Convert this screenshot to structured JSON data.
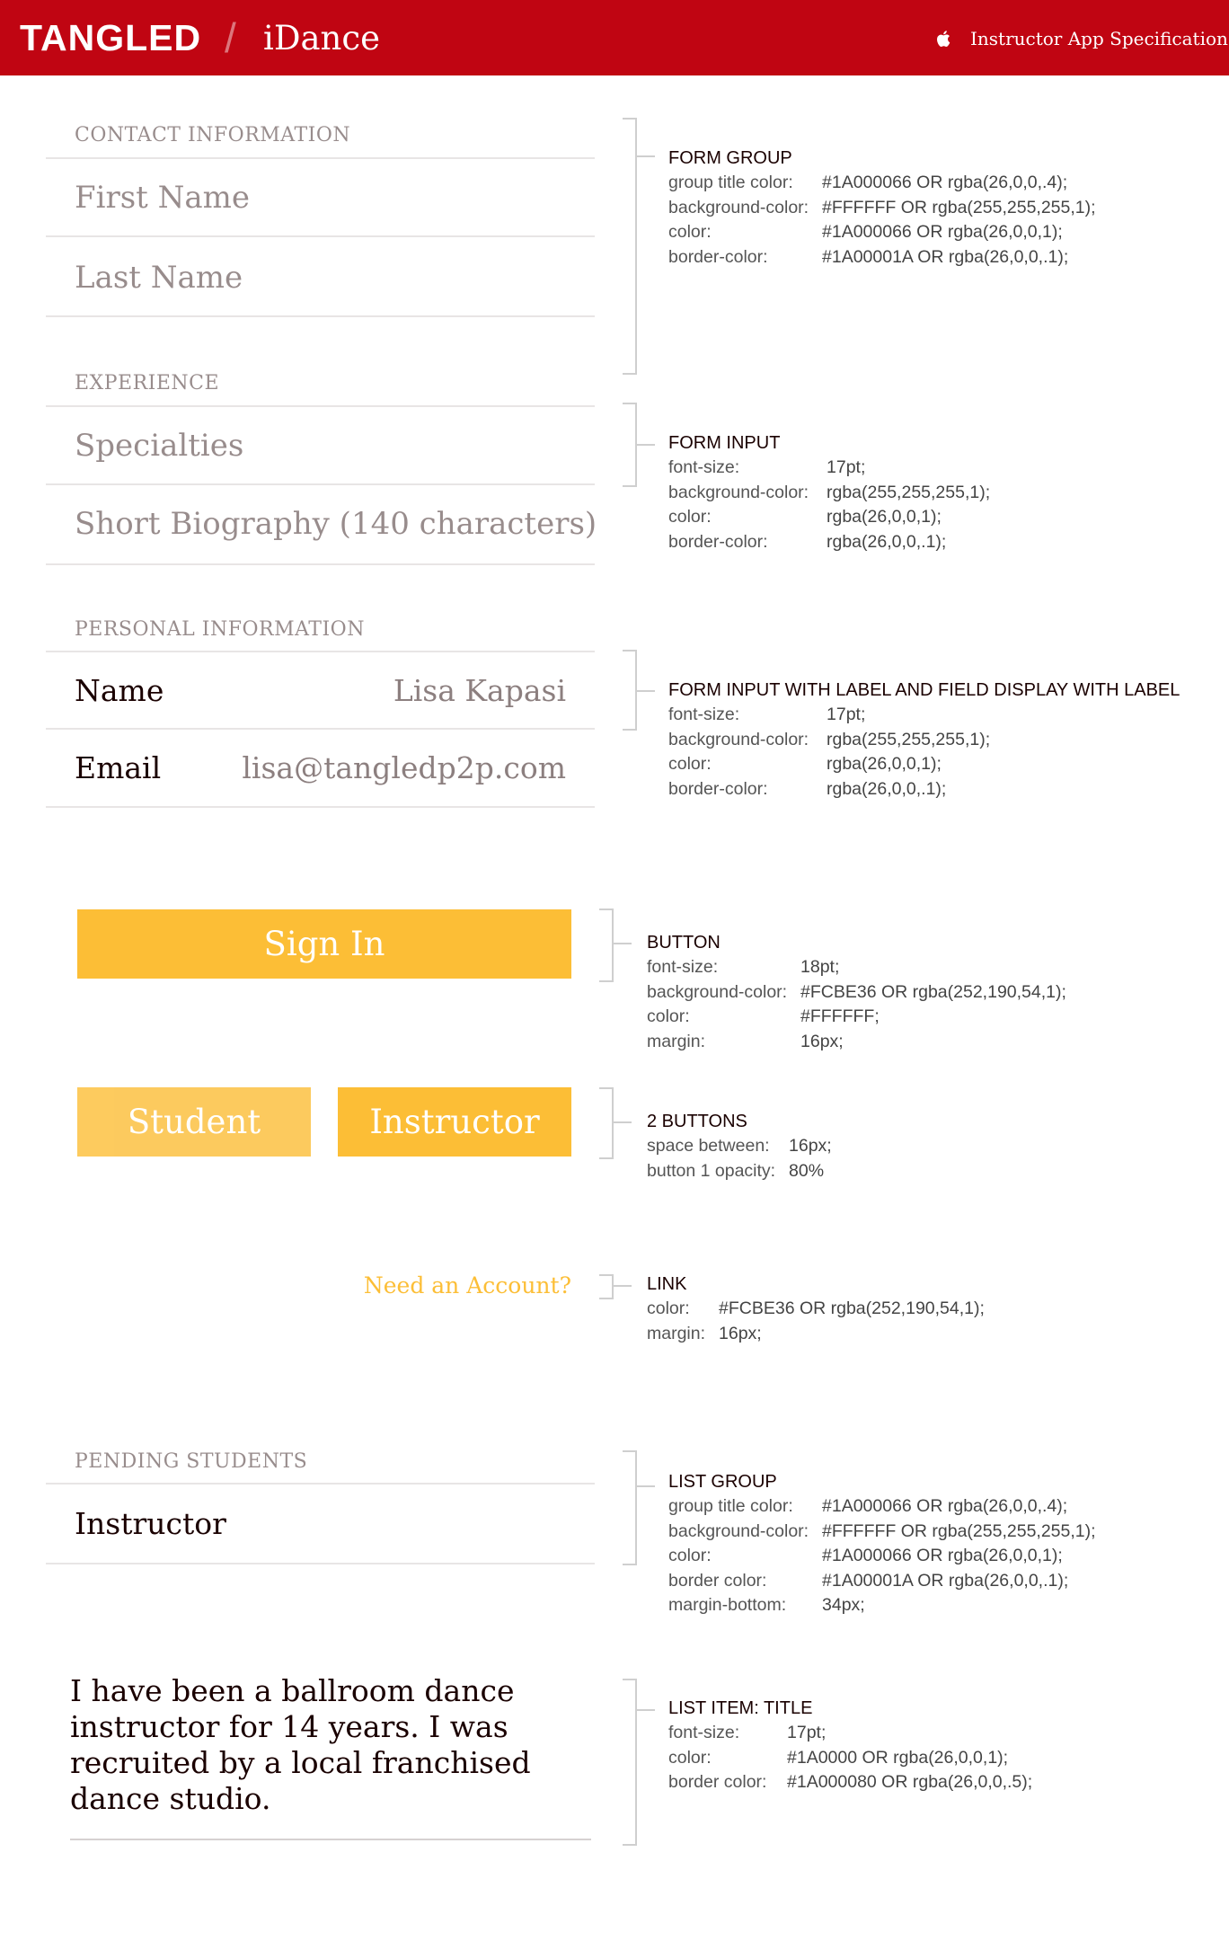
{
  "header": {
    "brand": "TANGLED",
    "separator": "/",
    "app_name": "iDance",
    "icon": "apple-icon",
    "title": "Instructor App Specifications",
    "color": "#C00512"
  },
  "contact": {
    "title": "CONTACT INFORMATION",
    "first_name": "First Name",
    "last_name": "Last Name"
  },
  "experience": {
    "title": "EXPERIENCE",
    "specialties": "Specialties",
    "bio": "Short Biography (140 characters)"
  },
  "personal": {
    "title": "PERSONAL INFORMATION",
    "rows": [
      {
        "label": "Name",
        "value": "Lisa Kapasi"
      },
      {
        "label": "Email",
        "value": "lisa@tangledp2p.com"
      }
    ]
  },
  "buttons": {
    "sign_in": "Sign In",
    "student": "Student",
    "instructor": "Instructor",
    "accent": "#FCBE36"
  },
  "link": {
    "need_account": "Need an Account?"
  },
  "pending": {
    "title": "PENDING STUDENTS",
    "item": "Instructor"
  },
  "bio_text": "I have been a ballroom dance instructor for 14 years. I was recruited by a local franchised dance studio.",
  "specs": [
    {
      "title": "FORM GROUP",
      "rows": [
        {
          "k": "group title color:",
          "v": "#1A000066 OR rgba(26,0,0,.4);"
        },
        {
          "k": "background-color:",
          "v": "#FFFFFF OR rgba(255,255,255,1);"
        },
        {
          "k": "color:",
          "v": "#1A000066 OR rgba(26,0,0,1);"
        },
        {
          "k": "border-color:",
          "v": "#1A00001A OR rgba(26,0,0,.1);"
        }
      ]
    },
    {
      "title": "FORM INPUT",
      "rows": [
        {
          "k": "font-size:",
          "v": "17pt;"
        },
        {
          "k": "background-color:",
          "v": "rgba(255,255,255,1);"
        },
        {
          "k": "color:",
          "v": "rgba(26,0,0,1);"
        },
        {
          "k": "border-color:",
          "v": "rgba(26,0,0,.1);"
        }
      ]
    },
    {
      "title": "FORM INPUT WITH LABEL AND FIELD DISPLAY WITH LABEL",
      "rows": [
        {
          "k": "font-size:",
          "v": "17pt;"
        },
        {
          "k": "background-color:",
          "v": "rgba(255,255,255,1);"
        },
        {
          "k": "color:",
          "v": "rgba(26,0,0,1);"
        },
        {
          "k": "border-color:",
          "v": "rgba(26,0,0,.1);"
        }
      ]
    },
    {
      "title": "BUTTON",
      "rows": [
        {
          "k": "font-size:",
          "v": "18pt;"
        },
        {
          "k": "background-color:",
          "v": "#FCBE36  OR rgba(252,190,54,1);"
        },
        {
          "k": "color:",
          "v": "#FFFFFF;"
        },
        {
          "k": "margin:",
          "v": "16px;"
        }
      ]
    },
    {
      "title": "2 BUTTONS",
      "rows": [
        {
          "k": "space between:",
          "v": "16px;"
        },
        {
          "k": "button 1 opacity:",
          "v": "80%"
        }
      ]
    },
    {
      "title": "LINK",
      "rows": [
        {
          "k": "color:",
          "v": "#FCBE36 OR rgba(252,190,54,1);"
        },
        {
          "k": "margin:",
          "v": "16px;"
        }
      ]
    },
    {
      "title": "LIST GROUP",
      "rows": [
        {
          "k": "group title color:",
          "v": "#1A000066 OR rgba(26,0,0,.4);"
        },
        {
          "k": "background-color:",
          "v": "#FFFFFF OR rgba(255,255,255,1);"
        },
        {
          "k": "color:",
          "v": "#1A000066 OR rgba(26,0,0,1);"
        },
        {
          "k": "border color:",
          "v": "#1A00001A OR rgba(26,0,0,.1);"
        },
        {
          "k": "margin-bottom:",
          "v": "34px;"
        }
      ]
    },
    {
      "title": "LIST ITEM: TITLE",
      "rows": [
        {
          "k": "font-size:",
          "v": "17pt;"
        },
        {
          "k": "color:",
          "v": "#1A0000 OR rgba(26,0,0,1);"
        },
        {
          "k": "border color:",
          "v": "#1A000080 OR rgba(26,0,0,.5);"
        }
      ]
    }
  ]
}
